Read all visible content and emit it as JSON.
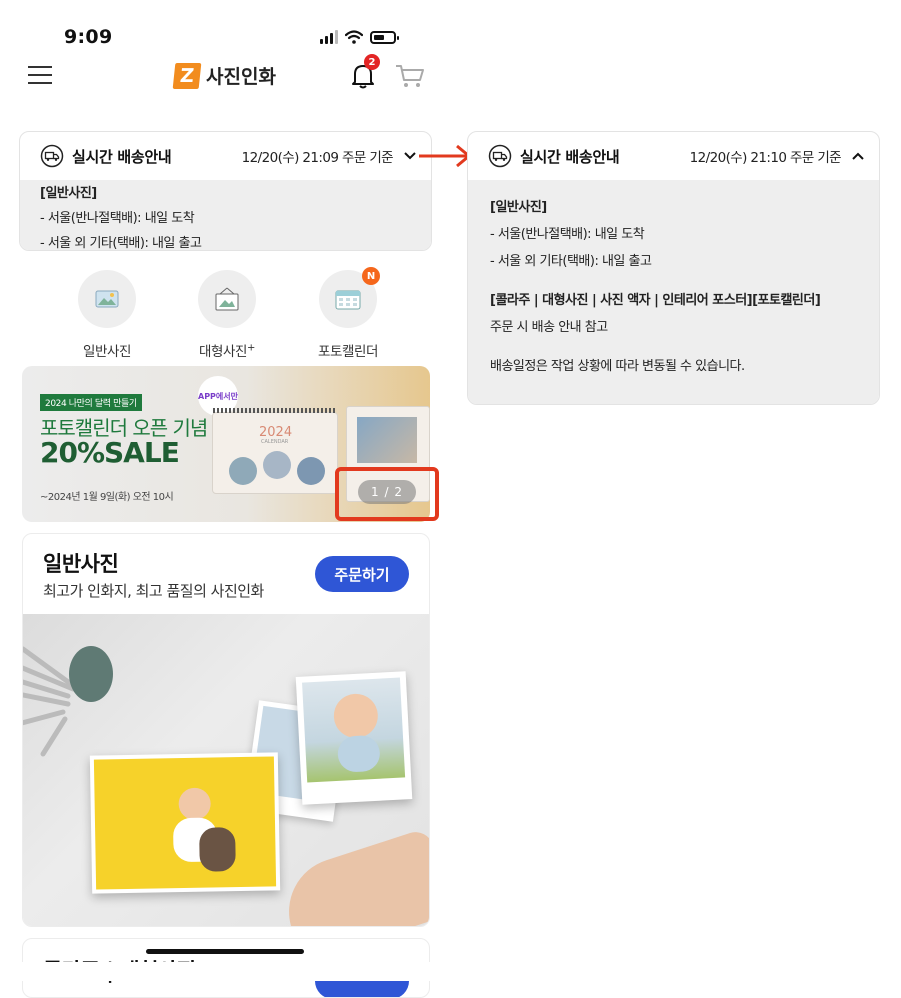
{
  "status_bar": {
    "time": "9:09"
  },
  "header": {
    "logo_mark": "Z",
    "logo_text": "사진인화",
    "bell_badge_count": "2",
    "icons": [
      "menu-icon",
      "bell-icon",
      "cart-icon"
    ]
  },
  "delivery_before": {
    "title": "실시간 배송안내",
    "date": "12/20(수) 21:09 주문 기준",
    "expanded": false,
    "lines": [
      "[일반사진]",
      "- 서울(반나절택배): 내일 도착",
      "- 서울 외 기타(택배): 내일 출고"
    ]
  },
  "delivery_after": {
    "title": "실시간 배송안내",
    "date": "12/20(수) 21:10 주문 기준",
    "expanded": true,
    "heading1": "[일반사진]",
    "line1": "- 서울(반나절택배): 내일 도착",
    "line2": "- 서울 외 기타(택배): 내일 출고",
    "heading2": "[콜라주 | 대형사진 | 사진 액자 | 인테리어 포스터][포토캘린더]",
    "line3": "주문 시 배송 안내 참고",
    "line4": "배송일정은 작업 상황에 따라 변동될 수 있습니다."
  },
  "categories": [
    {
      "label": "일반사진",
      "sup": ""
    },
    {
      "label": "대형사진",
      "sup": "+"
    },
    {
      "label": "포토캘린더",
      "sup": "",
      "badge": "N"
    }
  ],
  "banner": {
    "tag": "2024 나만의 달력 만들기",
    "line1": "포토캘린더 오픈 기념",
    "line2": "20%SALE",
    "date": "~2024년 1월 9일(화) 오전 10시",
    "app_only": "APP에서만",
    "calendar_year": "2024",
    "calendar_sub": "CALENDAR",
    "pager": "1 / 2"
  },
  "product": {
    "title": "일반사진",
    "subtitle": "최고가 인화지, 최고 품질의 사진인화",
    "button": "주문하기"
  },
  "product2": {
    "title": "콜라주 | 대형사진"
  },
  "colors": {
    "accent_orange": "#f28c1e",
    "primary_blue": "#2f56d6",
    "annotation_red": "#e2391e",
    "banner_green": "#1f7a3d"
  }
}
